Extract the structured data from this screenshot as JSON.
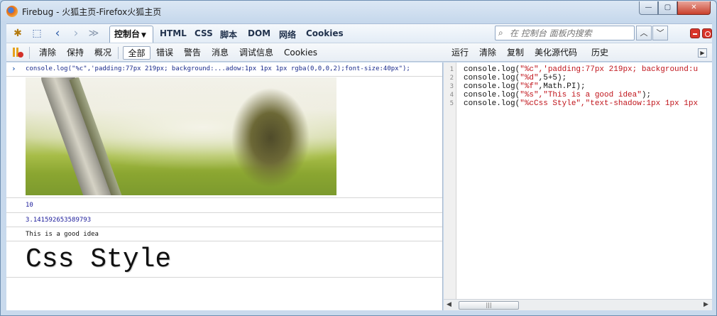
{
  "window": {
    "title": "Firebug - 火狐主页-Firefox火狐主页",
    "buttons": {
      "minimize": "—",
      "maximize": "▢",
      "close": "✕"
    }
  },
  "panel_tabs": {
    "active": "控制台",
    "items": [
      "HTML",
      "CSS",
      "脚本",
      "DOM",
      "网络",
      "Cookies"
    ]
  },
  "search": {
    "placeholder": "在 控制台 面板内搜索"
  },
  "nav": {
    "up": "︿",
    "down": "﹀"
  },
  "console_toolbar": {
    "clear": "清除",
    "persist": "保持",
    "profile": "概况",
    "all": "全部",
    "errors": "错误",
    "warnings": "警告",
    "info": "消息",
    "debug": "调试信息",
    "cookies": "Cookies"
  },
  "editor_toolbar": {
    "run": "运行",
    "clear": "清除",
    "copy": "复制",
    "pretty_print": "美化源代码",
    "history": "历史"
  },
  "console": {
    "prompt": "›",
    "command": "console.log(\"%c\",'padding:77px 219px; background:...adow:1px 1px 1px rgba(0,0,0,2);font-size:40px\");",
    "number_output": "10",
    "pi_output": "3.141592653589793",
    "string_output": "This is a good idea",
    "css_output": "Css Style"
  },
  "editor": {
    "line_numbers": [
      "1",
      "2",
      "3",
      "4",
      "5"
    ],
    "lines": [
      {
        "a": "console.log(",
        "s": "\"%c\",'padding:77px 219px; background:u",
        "b": ""
      },
      {
        "a": "console.log(",
        "s": "\"%d\"",
        "b": ",5+5);"
      },
      {
        "a": "console.log(",
        "s": "\"%f\"",
        "b": ",Math.PI);"
      },
      {
        "a": "console.log(",
        "s": "\"%s\",\"This is a good idea\"",
        "b": ");"
      },
      {
        "a": "console.log(",
        "s": "\"%cCss Style\",\"text-shadow:1px 1px 1px",
        "b": ""
      }
    ],
    "scroll_thumb_glyph": "|||"
  }
}
